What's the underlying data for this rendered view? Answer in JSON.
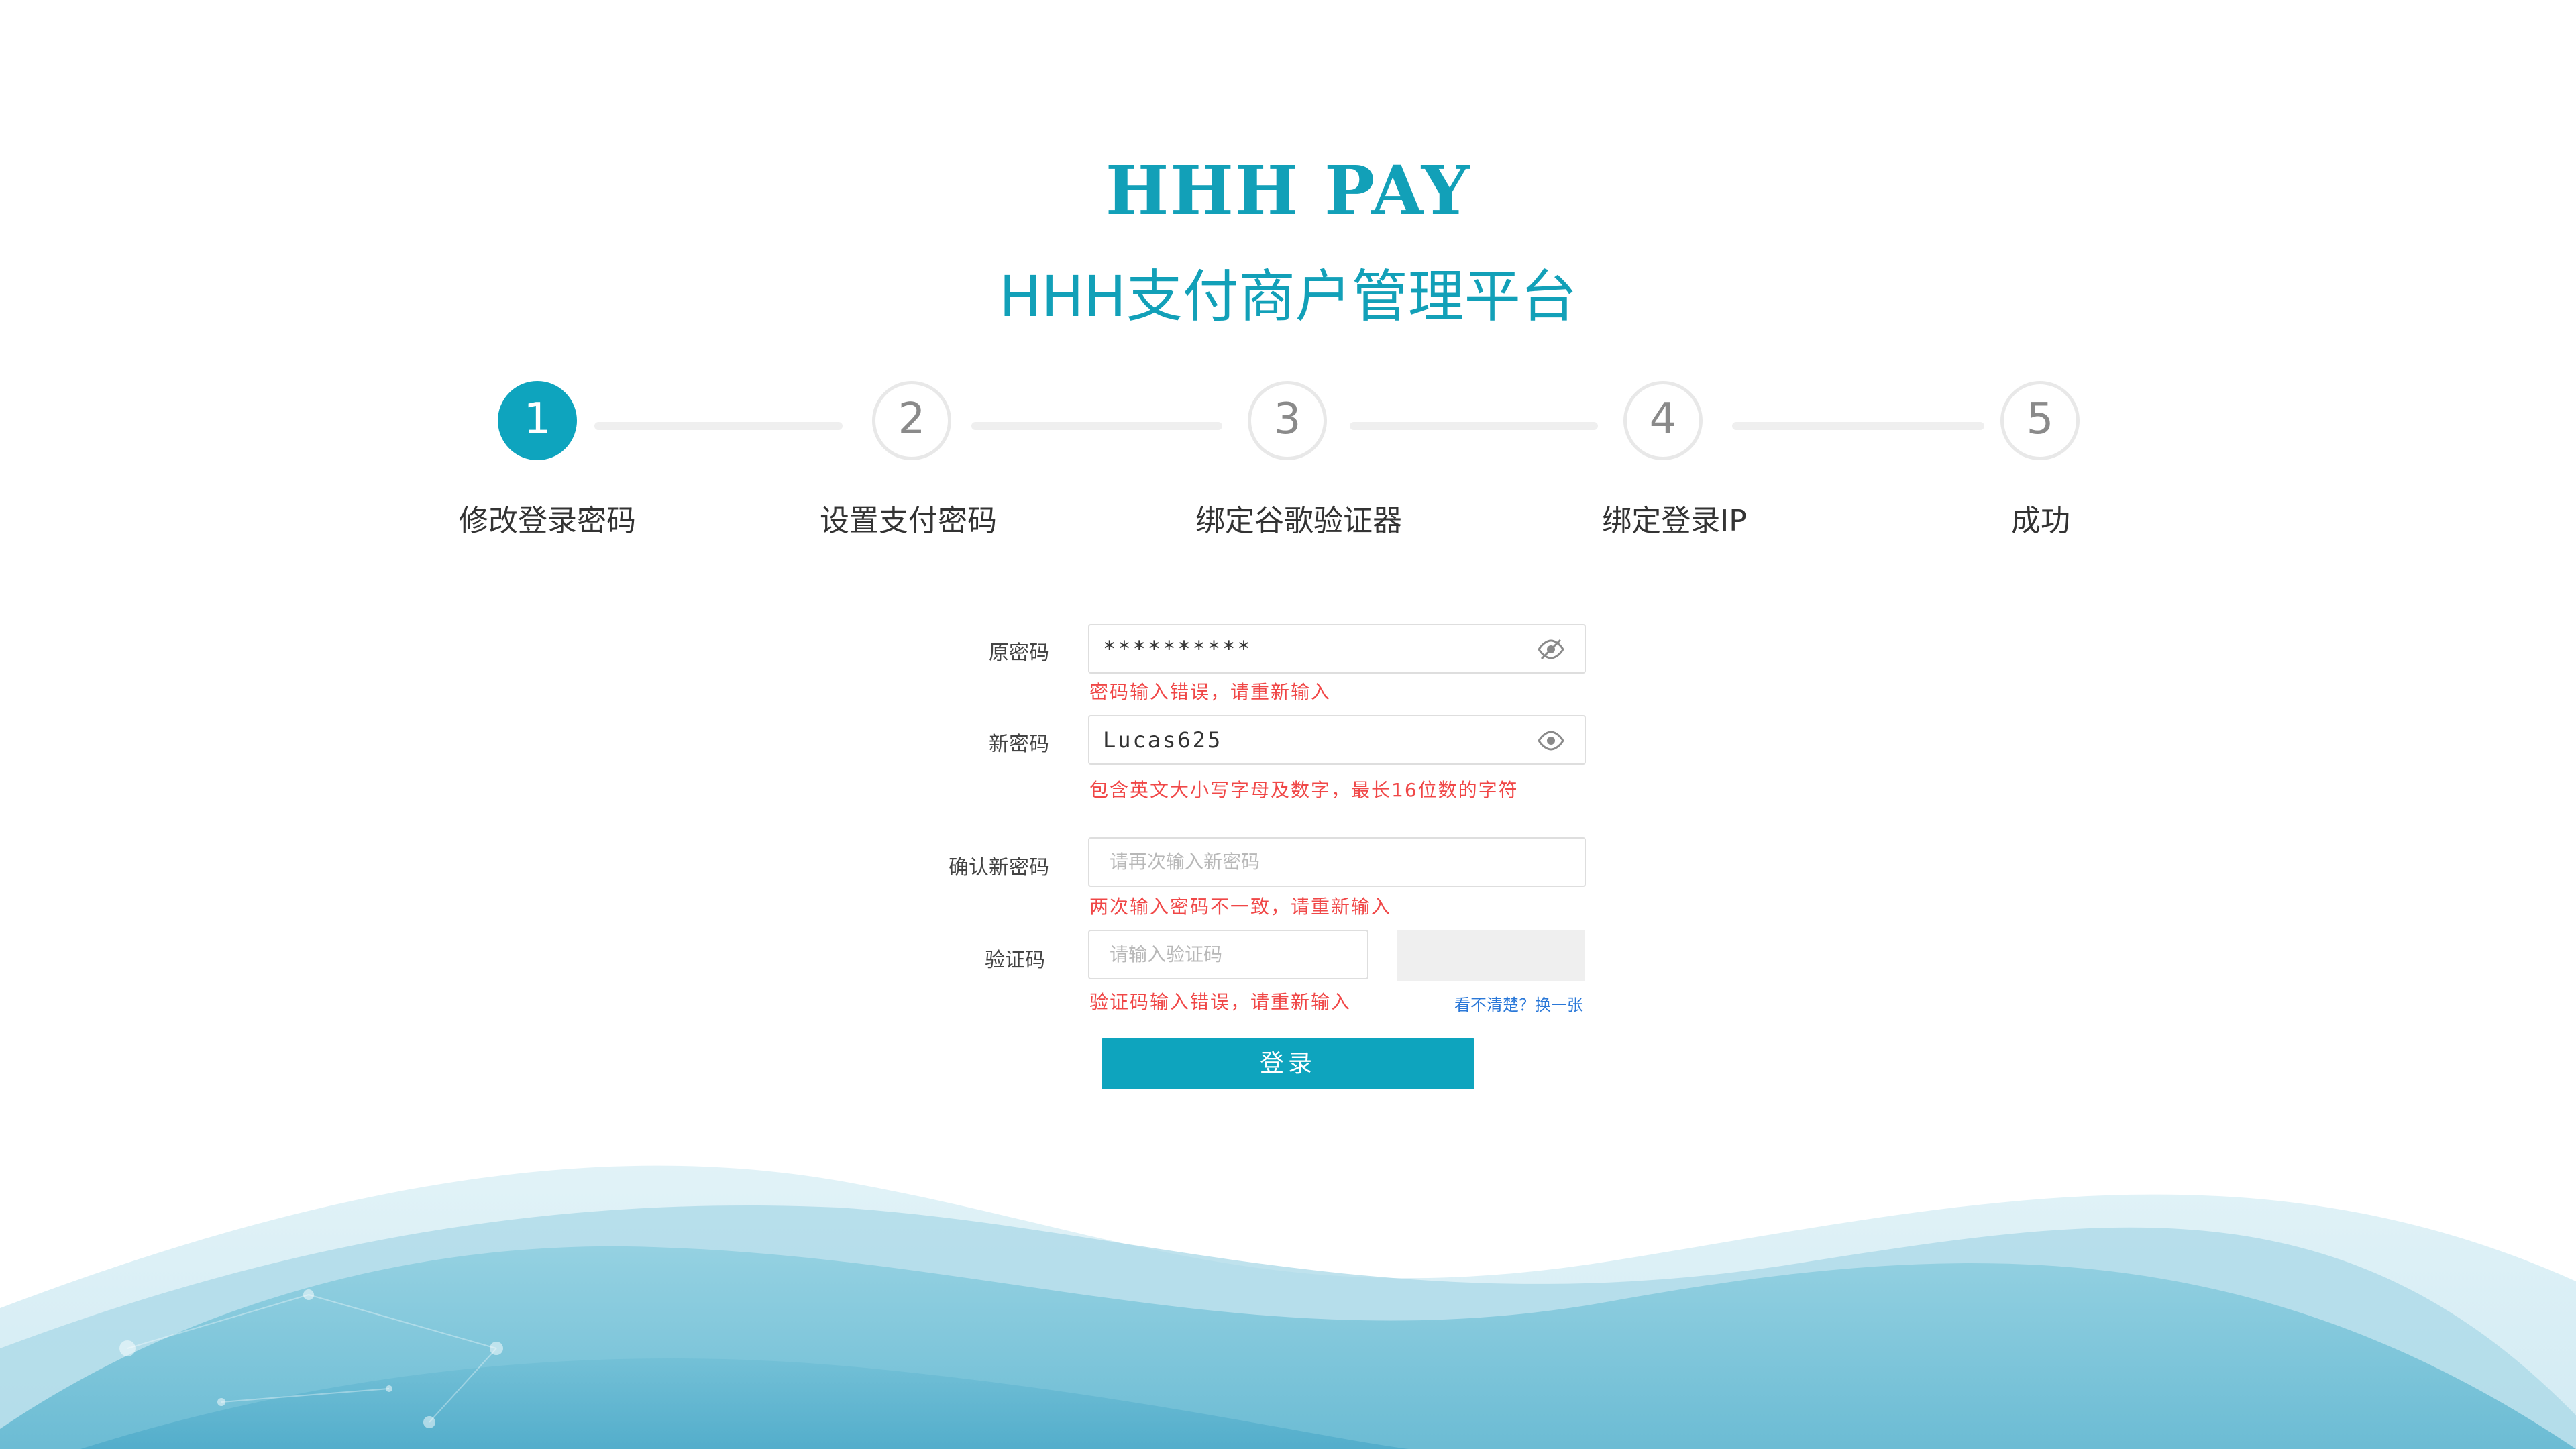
{
  "brand": {
    "logo_text": "HHH PAY",
    "subtitle": "HHH支付商户管理平台",
    "accent_color": "#0ea4be"
  },
  "steps": [
    {
      "number": "1",
      "label": "修改登录密码",
      "active": true
    },
    {
      "number": "2",
      "label": "设置支付密码",
      "active": false
    },
    {
      "number": "3",
      "label": "绑定谷歌验证器",
      "active": false
    },
    {
      "number": "4",
      "label": "绑定登录IP",
      "active": false
    },
    {
      "number": "5",
      "label": "成功",
      "active": false
    }
  ],
  "form": {
    "old_password": {
      "label": "原密码",
      "value": "**********",
      "icon": "eye-off-icon",
      "error": "密码输入错误，请重新输入"
    },
    "new_password": {
      "label": "新密码",
      "value": "Lucas625",
      "icon": "eye-icon",
      "hint": "包含英文大小写字母及数字，最长16位数的字符"
    },
    "confirm_password": {
      "label": "确认新密码",
      "placeholder": "请再次输入新密码",
      "error": "两次输入密码不一致，请重新输入"
    },
    "captcha": {
      "label": "验证码",
      "placeholder": "请输入验证码",
      "error": "验证码输入错误，请重新输入",
      "refresh_link": "看不清楚？换一张"
    },
    "submit_label": "登录"
  },
  "colors": {
    "error": "#f04747",
    "link": "#2a78d8"
  }
}
